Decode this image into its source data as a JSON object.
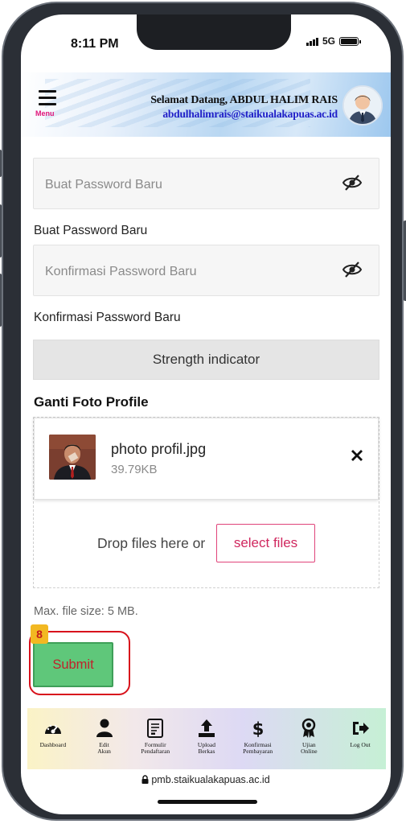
{
  "status": {
    "time": "8:11 PM",
    "network": "5G"
  },
  "header": {
    "menu_label": "Menu",
    "welcome": "Selamat Datang, ABDUL HALIM RAIS",
    "email": "abdulhalimrais@staikualakapuas.ac.id"
  },
  "form": {
    "new_password_placeholder": "Buat Password Baru",
    "new_password_label": "Buat Password Baru",
    "confirm_placeholder": "Konfirmasi Password Baru",
    "confirm_label": "Konfirmasi Password Baru",
    "strength": "Strength indicator",
    "photo_section": "Ganti Foto Profile",
    "file": {
      "name": "photo profil.jpg",
      "size": "39.79KB"
    },
    "drop_text": "Drop files here or",
    "select_files": "select files",
    "max_size": "Max. file size: 5 MB.",
    "badge": "8",
    "submit": "Submit"
  },
  "nav": [
    {
      "icon": "dashboard-icon",
      "label": "Dashboard"
    },
    {
      "icon": "user-icon",
      "label": "Edit\nAkun"
    },
    {
      "icon": "form-icon",
      "label": "Formulir\nPendaftaran"
    },
    {
      "icon": "upload-icon",
      "label": "Upload\nBerkas"
    },
    {
      "icon": "dollar-icon",
      "label": "Konfirmasi\nPembayaran"
    },
    {
      "icon": "award-icon",
      "label": "Ujian\nOnline"
    },
    {
      "icon": "logout-icon",
      "label": "Log Out"
    }
  ],
  "browser": {
    "url": "pmb.staikualakapuas.ac.id"
  },
  "colors": {
    "accent_pink": "#d0285f",
    "submit_green": "#5fc77a",
    "highlight_red": "#d8121c",
    "welcome_blue": "#2020c8"
  }
}
